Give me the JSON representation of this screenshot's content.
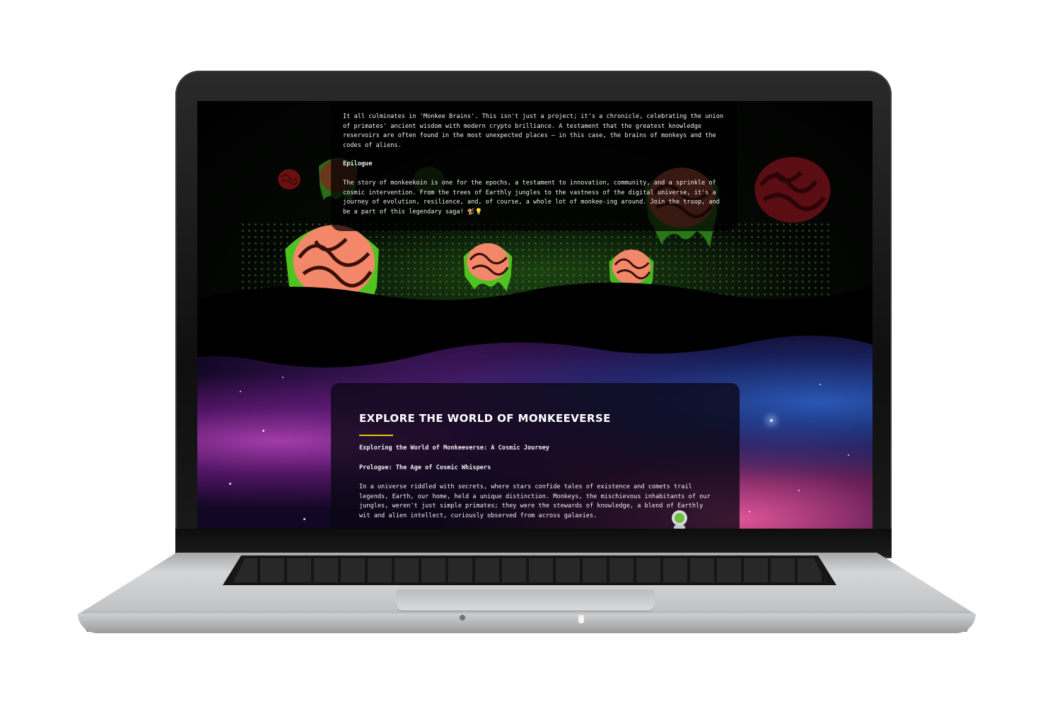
{
  "page": {
    "top_section": {
      "intro_paragraph": "It all culminates in 'Monkee Brains'. This isn't just a project; it's a chronicle, celebrating the union of primates' ancient wisdom with modern crypto brilliance. A testament that the greatest knowledge reservoirs are often found in the most unexpected places – in this case, the brains of monkeys and the codes of aliens.",
      "epilogue_heading": "Epilogue",
      "epilogue_paragraph": "The story of monkeekoin is one for the epochs, a testament to innovation, community, and a sprinkle of cosmic intervention. From the trees of Earthly jungles to the vastness of the digital universe, it's a journey of evolution, resilience, and, of course, a whole lot of monkee-ing around. Join the troop, and be a part of this legendary saga! 🐒💡"
    },
    "explore_section": {
      "title": "EXPLORE THE WORLD OF MONKEEVERSE",
      "subtitle": "Exploring the World of Monkeeverse: A Cosmic Journey",
      "prologue_heading": "Prologue: The Age of Cosmic Whispers",
      "prologue_paragraph": "In a universe riddled with secrets, where stars confide tales of existence and comets trail legends, Earth, our home, held a unique distinction. Monkeys, the mischievous inhabitants of our jungles, weren't just simple primates; they were the stewards of knowledge, a blend of Earthly wit and alien intellect, curiously observed from across galaxies."
    }
  },
  "colors": {
    "accent_rule": "#e6c619",
    "brain_pink": "#f2876a",
    "slime_green": "#5fd12a",
    "panel_bg": "#000000"
  },
  "icons": [
    "brain-icon",
    "alien-astronaut-icon"
  ]
}
